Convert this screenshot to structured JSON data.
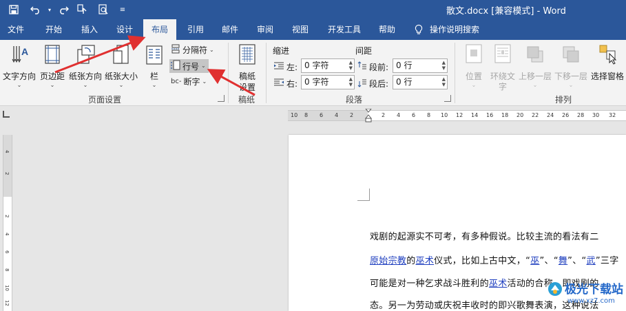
{
  "titlebar": {
    "title": "散文.docx [兼容模式] - Word",
    "bg_color": "#2b579a"
  },
  "tabs": [
    {
      "label": "文件"
    },
    {
      "label": "开始"
    },
    {
      "label": "插入"
    },
    {
      "label": "设计"
    },
    {
      "label": "布局"
    },
    {
      "label": "引用"
    },
    {
      "label": "邮件"
    },
    {
      "label": "审阅"
    },
    {
      "label": "视图"
    },
    {
      "label": "开发工具"
    },
    {
      "label": "帮助"
    },
    {
      "label": "操作说明搜索"
    }
  ],
  "ribbon": {
    "page_setup": {
      "text_direction": "文字方向",
      "margins": "页边距",
      "orientation": "纸张方向",
      "size": "纸张大小",
      "columns": "栏",
      "breaks": "分隔符",
      "line_numbers": "行号",
      "hyphenation": "断字",
      "group_label": "页面设置"
    },
    "manuscript": {
      "button_line1": "稿纸",
      "button_line2": "设置",
      "group_label": "稿纸"
    },
    "paragraph": {
      "indent_label": "缩进",
      "spacing_label": "间距",
      "left_label": "左:",
      "right_label": "右:",
      "before_label": "段前:",
      "after_label": "段后:",
      "left_value": "0 字符",
      "right_value": "0 字符",
      "before_value": "0 行",
      "after_value": "0 行",
      "group_label": "段落"
    },
    "arrange": {
      "position": "位置",
      "wrap_text_line1": "环绕文",
      "wrap_text_line2": "字",
      "bring_forward": "上移一层",
      "send_backward": "下移一层",
      "selection_pane": "选择窗格",
      "group_label": "排列"
    }
  },
  "ruler": {
    "h_ticks": [
      "10",
      "8",
      "6",
      "4",
      "2",
      "2",
      "4",
      "6",
      "8",
      "10",
      "12",
      "14",
      "16",
      "18",
      "20",
      "22",
      "24",
      "26",
      "28",
      "30",
      "32"
    ],
    "v_ticks": [
      "4",
      "2",
      "2",
      "4",
      "6",
      "8",
      "10",
      "12"
    ]
  },
  "document": {
    "line1": "戏剧的起源实不可考，有多种假说。比较主流的看法有二",
    "line2_link1": "原始宗教",
    "line2_mid1": "的",
    "line2_link2": "巫术",
    "line2_mid2": "仪式，比如上古中文，“",
    "line2_link3": "巫",
    "line2_mid3": "”、“",
    "line2_link4": "舞",
    "line2_mid4": "”、“",
    "line2_link5": "武",
    "line2_end": "”三字",
    "line3_start": "可能是对一种乞求战斗胜利的",
    "line3_link": "巫术",
    "line3_end": "活动的合称，即戏剧的",
    "line4": "态。另一为劳动或庆祝丰收时的即兴歌舞表演，这种说法"
  },
  "watermark": {
    "text": "极光下载站",
    "url": "www.xz7.com"
  },
  "colors": {
    "accent": "#2b579a",
    "arrow": "#e03030",
    "link": "#1f3fbf"
  }
}
